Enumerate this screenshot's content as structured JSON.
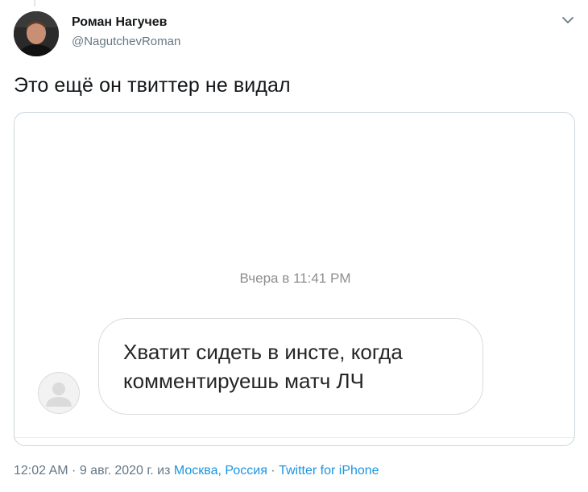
{
  "tweet": {
    "author": {
      "name": "Роман Нагучев",
      "handle": "@NagutchevRoman"
    },
    "text": "Это ещё он твиттер не видал",
    "menu_icon": "chevron-down-icon",
    "media": {
      "chat_timestamp": "Вчера в 11:41 PM",
      "message": "Хватит сидеть в инсте, когда\nкомментируешь матч ЛЧ",
      "sender_avatar_icon": "default-user-icon"
    },
    "meta": {
      "time_date": "12:02 AM · 9 авг. 2020 г. из ",
      "location": "Москва, Россия",
      "separator": " · ",
      "source": "Twitter for iPhone"
    }
  },
  "colors": {
    "text_primary": "#14171a",
    "text_secondary": "#657786",
    "link": "#1b95e0",
    "border": "#ccd6dd",
    "bubble_border": "#dbdbdb",
    "chat_timestamp": "#8e8e8e"
  }
}
